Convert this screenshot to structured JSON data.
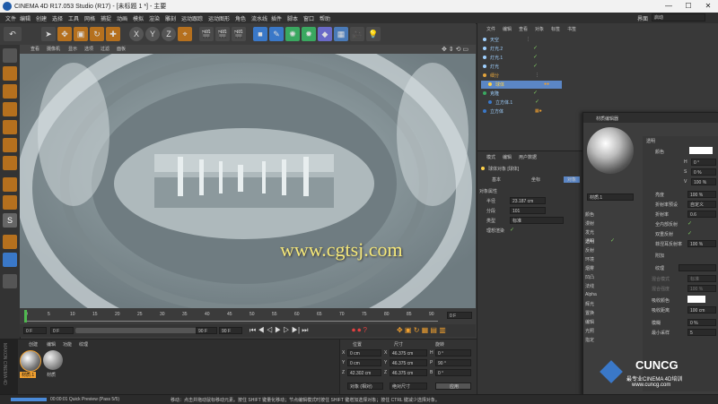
{
  "window": {
    "title": "CINEMA 4D R17.053 Studio (R17) - [未标题 1 *] - 主要",
    "layout_label": "界面",
    "layout_value": "启动"
  },
  "menu": [
    "文件",
    "编辑",
    "创建",
    "选择",
    "工具",
    "网格",
    "捕捉",
    "动画",
    "模拟",
    "渲染",
    "雕刻",
    "运动跟踪",
    "运动图形",
    "角色",
    "流水线",
    "插件",
    "脚本",
    "窗口",
    "帮助"
  ],
  "toolbar": {
    "axis_labels": [
      "X",
      "Y",
      "Z"
    ]
  },
  "viewport": {
    "menu": [
      "查看",
      "摄像机",
      "显示",
      "选项",
      "过滤",
      "面板"
    ],
    "watermark": "www.cgtsj.com"
  },
  "timeline": {
    "ticks": [
      "0",
      "5",
      "10",
      "15",
      "20",
      "25",
      "30",
      "35",
      "40",
      "45",
      "50",
      "55",
      "60",
      "65",
      "70",
      "75",
      "80",
      "85",
      "90"
    ],
    "end_label": "0 F"
  },
  "playback": {
    "current": "0 F",
    "start": "0 F",
    "end": "90 F",
    "end2": "90 F"
  },
  "material_manager": {
    "menu": [
      "创建",
      "编辑",
      "功能",
      "纹理"
    ],
    "items": [
      "材质.1",
      "材质"
    ]
  },
  "coords": {
    "headers": [
      "位置",
      "尺寸",
      "旋转"
    ],
    "rows": [
      {
        "axis": "X",
        "pos": "0 cm",
        "size_axis": "X",
        "size": "46.375 cm",
        "rot_axis": "H",
        "rot": "0 °"
      },
      {
        "axis": "Y",
        "pos": "0 cm",
        "size_axis": "Y",
        "size": "46.375 cm",
        "rot_axis": "P",
        "rot": "90 °"
      },
      {
        "axis": "Z",
        "pos": "42.302 cm",
        "size_axis": "Z",
        "size": "46.375 cm",
        "rot_axis": "B",
        "rot": "0 °"
      }
    ],
    "mode1": "对象 (相对)",
    "mode2": "绝对尺寸",
    "apply": "应用"
  },
  "object_manager": {
    "menu": [
      "文件",
      "编辑",
      "查看",
      "对象",
      "标签",
      "书签"
    ],
    "objects": [
      {
        "name": "天空",
        "color": "#9fd0ff"
      },
      {
        "name": "灯光.2",
        "color": "#9fd0ff"
      },
      {
        "name": "灯光.1",
        "color": "#9fd0ff"
      },
      {
        "name": "灯光",
        "color": "#9fd0ff"
      },
      {
        "name": "细分",
        "color": "#e2a33c"
      },
      {
        "name": "球体",
        "color": "#ffd24a"
      },
      {
        "name": "克隆",
        "color": "#9fd0ff"
      },
      {
        "name": "立方体.1",
        "color": "#9fd0ff"
      },
      {
        "name": "立方体",
        "color": "#9fd0ff"
      }
    ]
  },
  "attributes": {
    "menu": [
      "模式",
      "编辑",
      "用户数据"
    ],
    "object_title": "球体对象 [球体]",
    "tabs": [
      "基本",
      "坐标",
      "对象"
    ],
    "section": "对象属性",
    "props": [
      {
        "label": "半径",
        "value": "23.187 cm"
      },
      {
        "label": "分段",
        "value": "101"
      },
      {
        "label": "类型",
        "value": "标准"
      },
      {
        "label": "理想渲染",
        "value": "✓"
      }
    ]
  },
  "material_editor": {
    "title": "材质编辑器",
    "material_name": "材质.1",
    "channels": [
      "颜色",
      "漫射",
      "发光",
      "透明",
      "反射",
      "环境",
      "烟雾",
      "凹凸",
      "法线",
      "Alpha",
      "辉光",
      "置换",
      "编辑",
      "光照",
      "指定"
    ],
    "checked_channel": "透明",
    "section": "透明",
    "right_props": [
      {
        "label": "颜色",
        "value": ""
      },
      {
        "label": "H",
        "value": "0 °"
      },
      {
        "label": "S",
        "value": "0 %"
      },
      {
        "label": "V",
        "value": "100 %"
      },
      {
        "label": "亮度",
        "value": "100 %"
      },
      {
        "label": "折射率预设",
        "value": "自定义"
      },
      {
        "label": "折射率",
        "value": "0.6"
      },
      {
        "label": "全内部反射",
        "value": "✓"
      },
      {
        "label": "双重反射",
        "value": "✓"
      },
      {
        "label": "菲涅耳反射率",
        "value": "100 %"
      },
      {
        "label": "附加",
        "value": ""
      },
      {
        "label": "纹理",
        "value": ""
      },
      {
        "label": "混合模式",
        "value": "标准"
      },
      {
        "label": "混合强度",
        "value": "100 %"
      },
      {
        "label": "吸收颜色",
        "value": ""
      },
      {
        "label": "吸收距离",
        "value": "100 cm"
      },
      {
        "label": "模糊",
        "value": "0 %"
      },
      {
        "label": "最小采样",
        "value": "5"
      }
    ]
  },
  "status": {
    "time": "00:00:01 Quick Preview (Pass 5/5)",
    "hint": "移动：点击并拖动鼠标移动元素。按住 SHIFT 键量化移动；节点编辑模式时按住 SHIFT 键增加选择对象；按住 CTRL 键减少选择对象。"
  },
  "brand": {
    "logo_text": "CUNCG",
    "slogan": "最专业CINEMA 4D培训",
    "url": "www.cuncg.com",
    "side_logo": "MAXON CINEMA 4D"
  },
  "colors": {
    "accent": "#f0a030",
    "selected": "#5b86c5"
  }
}
